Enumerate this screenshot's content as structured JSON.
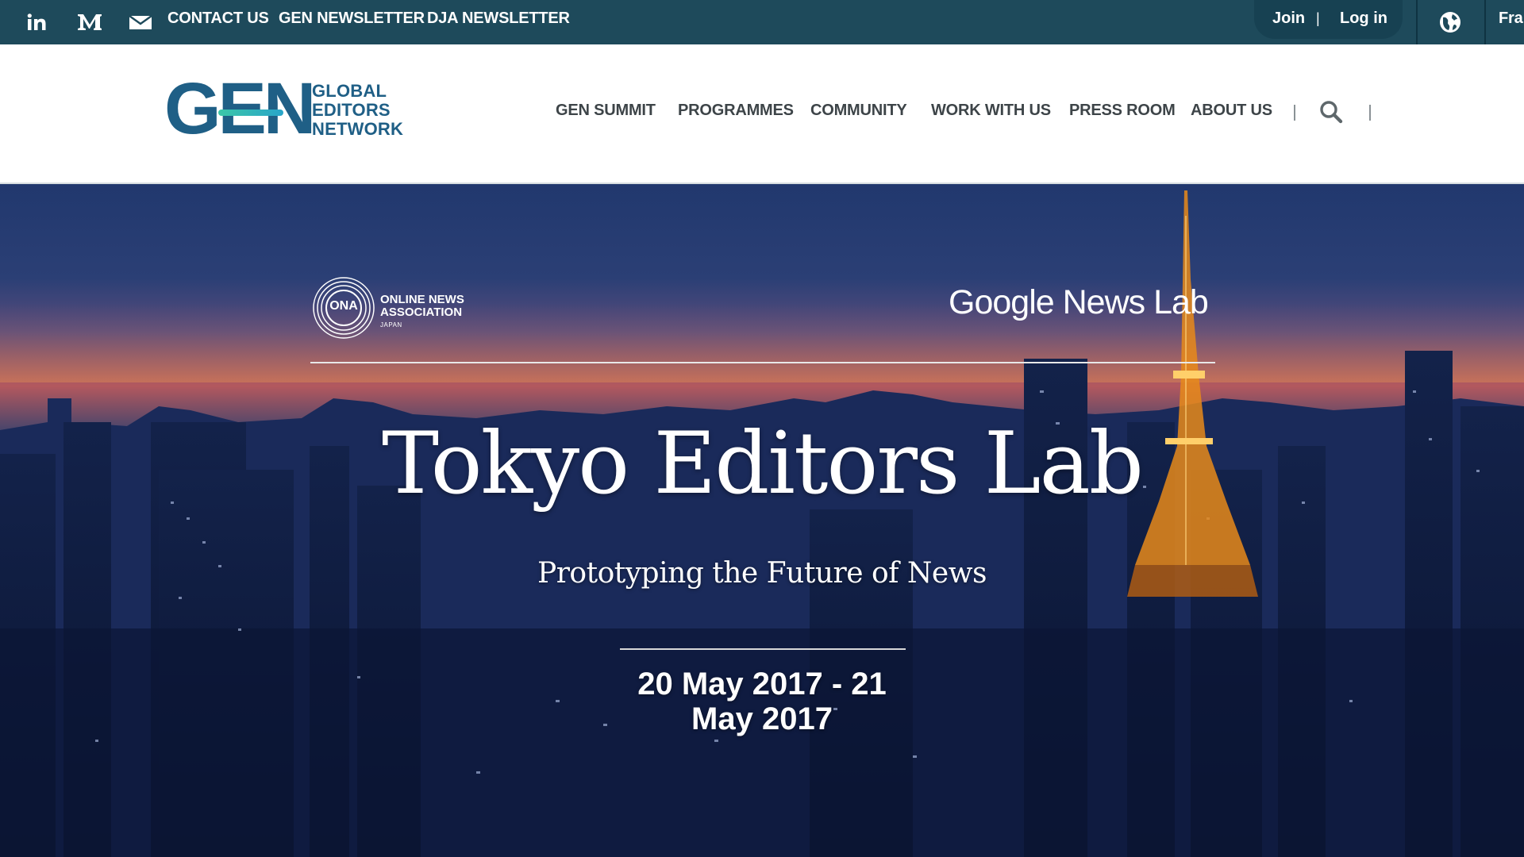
{
  "topbar": {
    "contact": "CONTACT US",
    "gen_newsletter": "GEN NEWSLETTER",
    "dja_newsletter": "DJA NEWSLETTER",
    "join": "Join",
    "divider": "|",
    "login": "Log in",
    "language": "Fra",
    "icons": [
      "linkedin-icon",
      "medium-icon",
      "mail-icon",
      "globe-icon"
    ]
  },
  "header": {
    "logo_mark": "GEN",
    "logo_words": [
      "GLOBAL",
      "EDITORS",
      "NETWORK"
    ],
    "nav": [
      "GEN SUMMIT",
      "PROGRAMMES",
      "COMMUNITY",
      "WORK WITH US",
      "PRESS ROOM",
      "ABOUT US"
    ],
    "nav_divider": "|",
    "search_icon": "search-icon"
  },
  "hero": {
    "ona": {
      "mark": "ONA",
      "line1": "ONLINE NEWS",
      "line2": "ASSOCIATION",
      "line3": "JAPAN"
    },
    "partner": "Google News Lab",
    "title": "Tokyo Editors Lab",
    "subtitle": "Prototyping the Future of News",
    "date_line1": "20 May 2017 - 21",
    "date_line2": "May 2017"
  },
  "colors": {
    "topbar": "#1e4a5b",
    "brand_blue": "#1f5f86",
    "brand_teal": "#3cc6a8",
    "nav_text": "#3d4448"
  }
}
